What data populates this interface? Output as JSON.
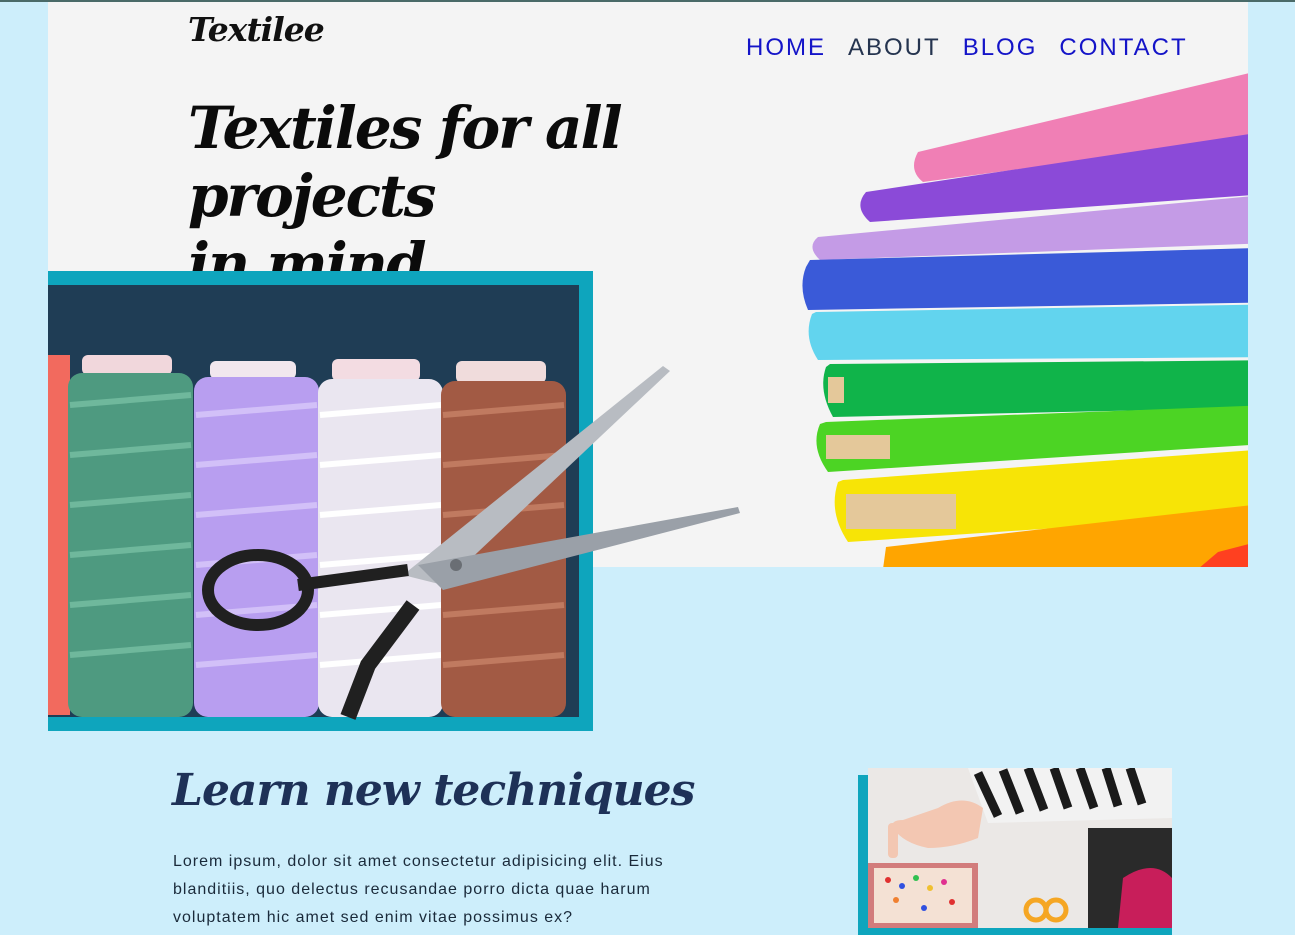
{
  "logo": "Textilee",
  "nav": [
    {
      "label": "HOME"
    },
    {
      "label": "ABOUT"
    },
    {
      "label": "BLOG"
    },
    {
      "label": "CONTACT"
    }
  ],
  "hero": {
    "headline_line1": "Textiles for all projects",
    "headline_line2": "in mind"
  },
  "section": {
    "title": "Learn new techniques",
    "paragraph": "Lorem ipsum, dolor sit amet consectetur adipisicing elit. Eius blanditiis, quo delectus recusandae porro dicta quae harum voluptatem hic amet sed enim vitae possimus ex?"
  },
  "colors": {
    "page_background": "#cdeefb",
    "hero_background": "#f4f4f4",
    "accent_teal": "#0ea5bd",
    "heading_navy": "#1e3157",
    "nav_blue": "#1414c8"
  }
}
